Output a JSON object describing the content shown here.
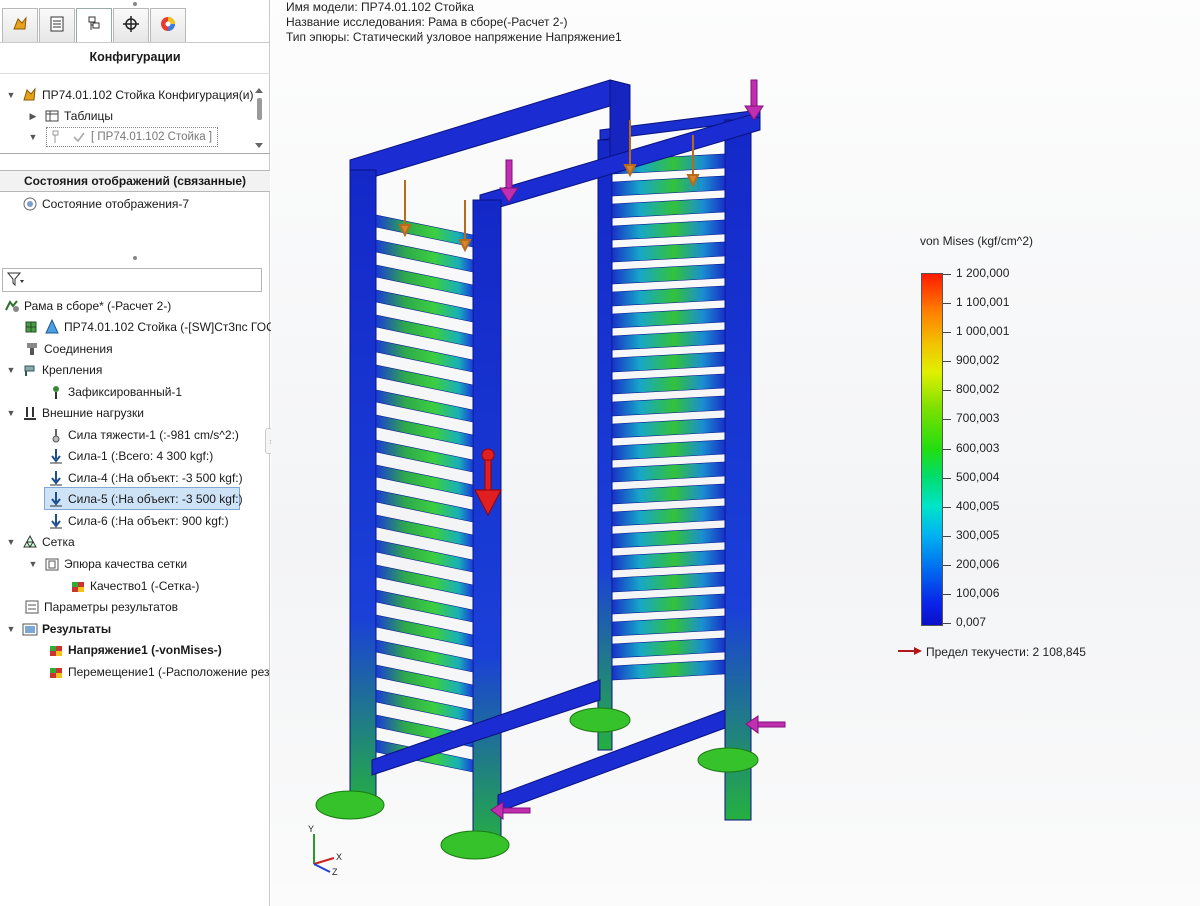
{
  "sidebar": {
    "tabs": [
      {
        "icon": "feature-manager-icon"
      },
      {
        "icon": "property-manager-icon"
      },
      {
        "icon": "configuration-manager-icon"
      },
      {
        "icon": "dimxpert-icon"
      },
      {
        "icon": "display-manager-icon"
      }
    ],
    "config_title": "Конфигурации",
    "config_tree": {
      "root": "ПР74.01.102 Стойка Конфигурация(и)",
      "tables": "Таблицы",
      "config_item": "[ ПР74.01.102 Стойка ]"
    },
    "display_states_title": "Состояния отображений (связанные)",
    "display_state": "Состояние отображения-7",
    "study_tree": {
      "root": "Рама в сборе* (-Расчет 2-)",
      "part": "ПР74.01.102 Стойка (-[SW]Ст3пс ГОС",
      "connections": "Соединения",
      "fixtures": "Крепления",
      "fixed": "Зафиксированный-1",
      "loads": "Внешние нагрузки",
      "gravity": "Сила тяжести-1 (:-981 cm/s^2:)",
      "force1": "Сила-1 (:Всего: 4 300 kgf:)",
      "force4": "Сила-4 (:На объект: -3 500 kgf:)",
      "force5": "Сила-5 (:На объект: -3 500 kgf:)",
      "force6": "Сила-6 (:На объект: 900 kgf:)",
      "mesh": "Сетка",
      "mesh_plot": "Эпюра качества сетки",
      "quality": "Качество1 (-Сетка-)",
      "result_options": "Параметры результатов",
      "results": "Результаты",
      "stress": "Напряжение1 (-vonMises-)",
      "displacement": "Перемещение1 (-Расположение рез"
    }
  },
  "viewport": {
    "model_name": "Имя модели: ПР74.01.102 Стойка",
    "study_name": "Название исследования: Рама в сборе(-Расчет 2-)",
    "plot_type": "Тип эпюры: Статический узловое напряжение Напряжение1",
    "legend": {
      "title": "von Mises (kgf/cm^2)",
      "ticks": [
        "1 200,000",
        "1 100,001",
        "1 000,001",
        "900,002",
        "800,002",
        "700,003",
        "600,003",
        "500,004",
        "400,005",
        "300,005",
        "200,006",
        "100,006",
        "0,007"
      ],
      "yield_label": "Предел текучести: 2 108,845",
      "colors": {
        "max": "#ff1a00",
        "mid": "#22dd11",
        "min": "#0b10c8"
      }
    },
    "triad": {
      "x": "X",
      "y": "Y",
      "z": "Z"
    }
  }
}
